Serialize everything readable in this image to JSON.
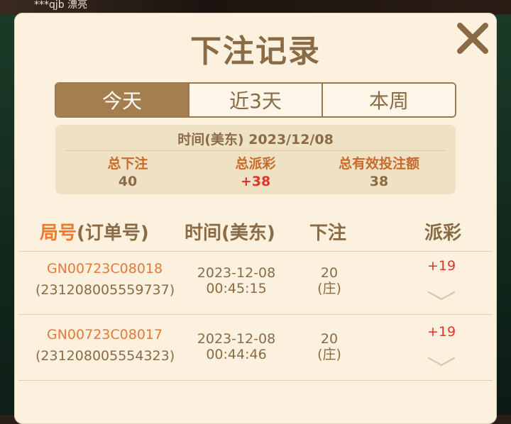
{
  "background": {
    "top_text": "***qjb 漂亮"
  },
  "dialog": {
    "title": "下注记录",
    "close_icon": "close-icon"
  },
  "tabs": [
    {
      "label": "今天",
      "active": true
    },
    {
      "label": "近3天",
      "active": false
    },
    {
      "label": "本周",
      "active": false
    }
  ],
  "summary": {
    "time_label": "时间(美东) 2023/12/08",
    "total_bet_label": "总下注",
    "total_bet_value": "40",
    "total_payout_label": "总派彩",
    "total_payout_value": "+38",
    "total_valid_label": "总有效投注额",
    "total_valid_value": "38"
  },
  "table": {
    "headers": {
      "round_accent": "局号",
      "round_rest": "(订单号)",
      "time": "时间(美东)",
      "bet": "下注",
      "payout": "派彩"
    },
    "rows": [
      {
        "order_no": "GN00723C08018",
        "order_id": "(231208005559737)",
        "date": "2023-12-08",
        "time": "00:45:15",
        "bet_amount": "20",
        "bet_side": "(庄)",
        "payout": "+19"
      },
      {
        "order_no": "GN00723C08017",
        "order_id": "(231208005554323)",
        "date": "2023-12-08",
        "time": "00:44:46",
        "bet_amount": "20",
        "bet_side": "(庄)",
        "payout": "+19"
      }
    ]
  },
  "colors": {
    "panel_bg": "#fbf1de",
    "accent_brown": "#8b6b45",
    "active_tab": "#a47e4f",
    "orange": "#f07a2c",
    "red": "#e0342b"
  }
}
